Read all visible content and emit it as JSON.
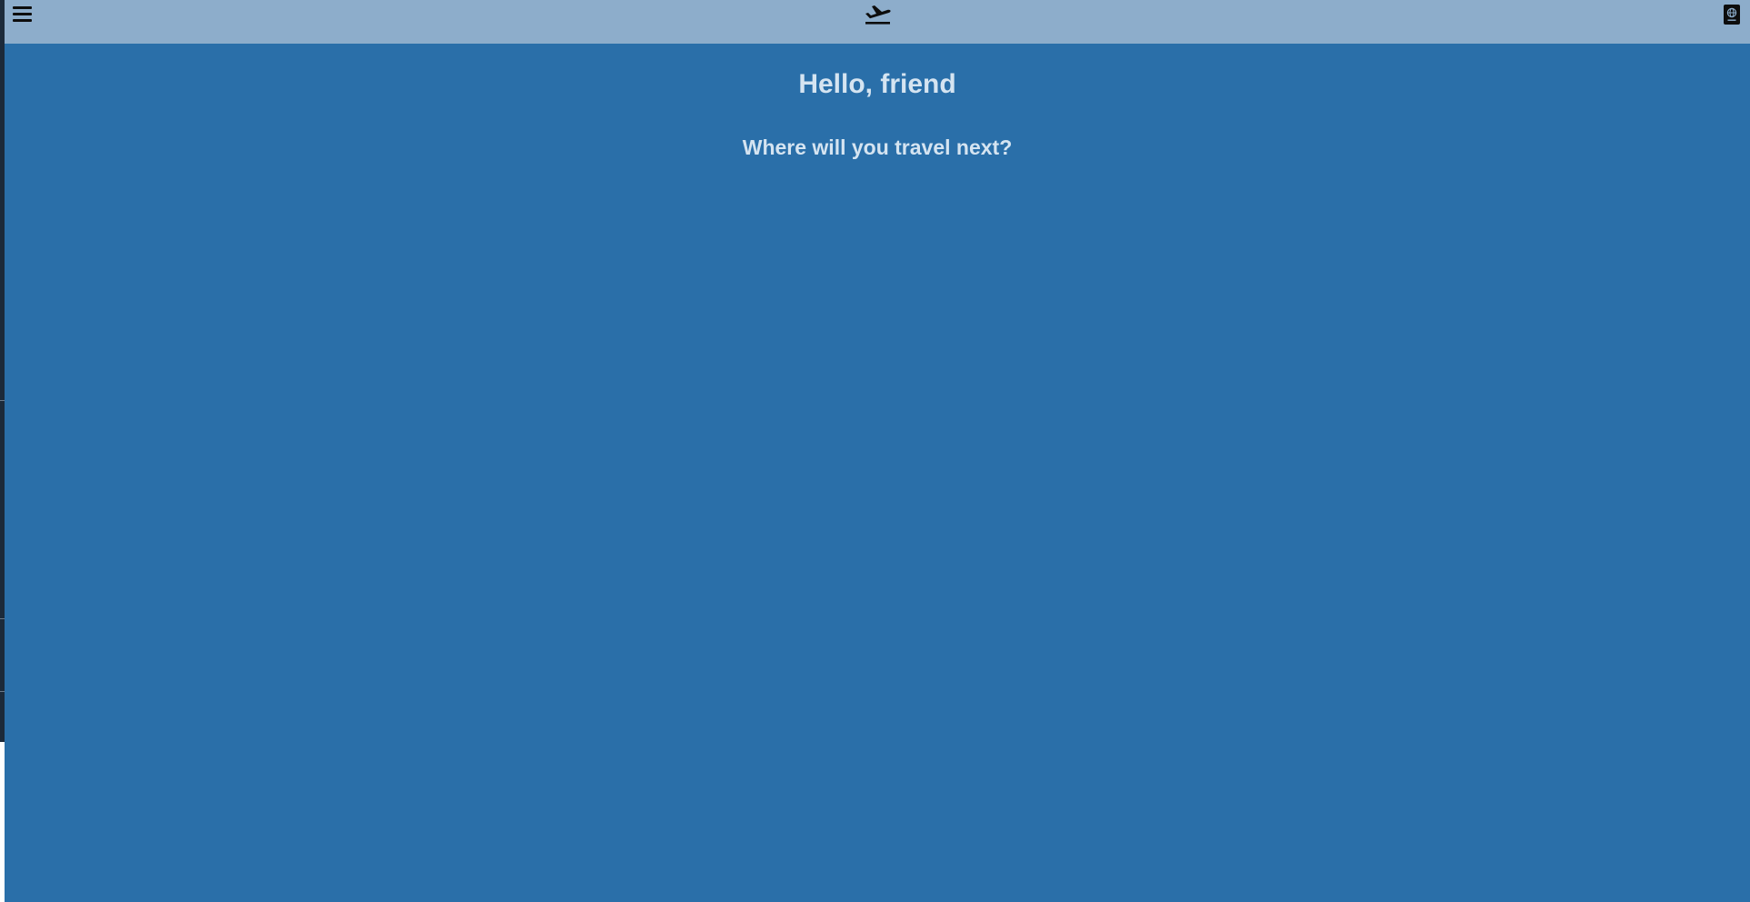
{
  "header": {
    "menu_icon": "hamburger-menu-icon",
    "logo_icon": "airplane-departure-icon",
    "passport_icon": "passport-icon"
  },
  "main": {
    "greeting": "Hello, friend",
    "prompt": "Where will you travel next?"
  },
  "colors": {
    "topbar": "#8dadcb",
    "background": "#2a6fa9",
    "text": "#d5e4f1",
    "icons": "#0d0d0d"
  }
}
